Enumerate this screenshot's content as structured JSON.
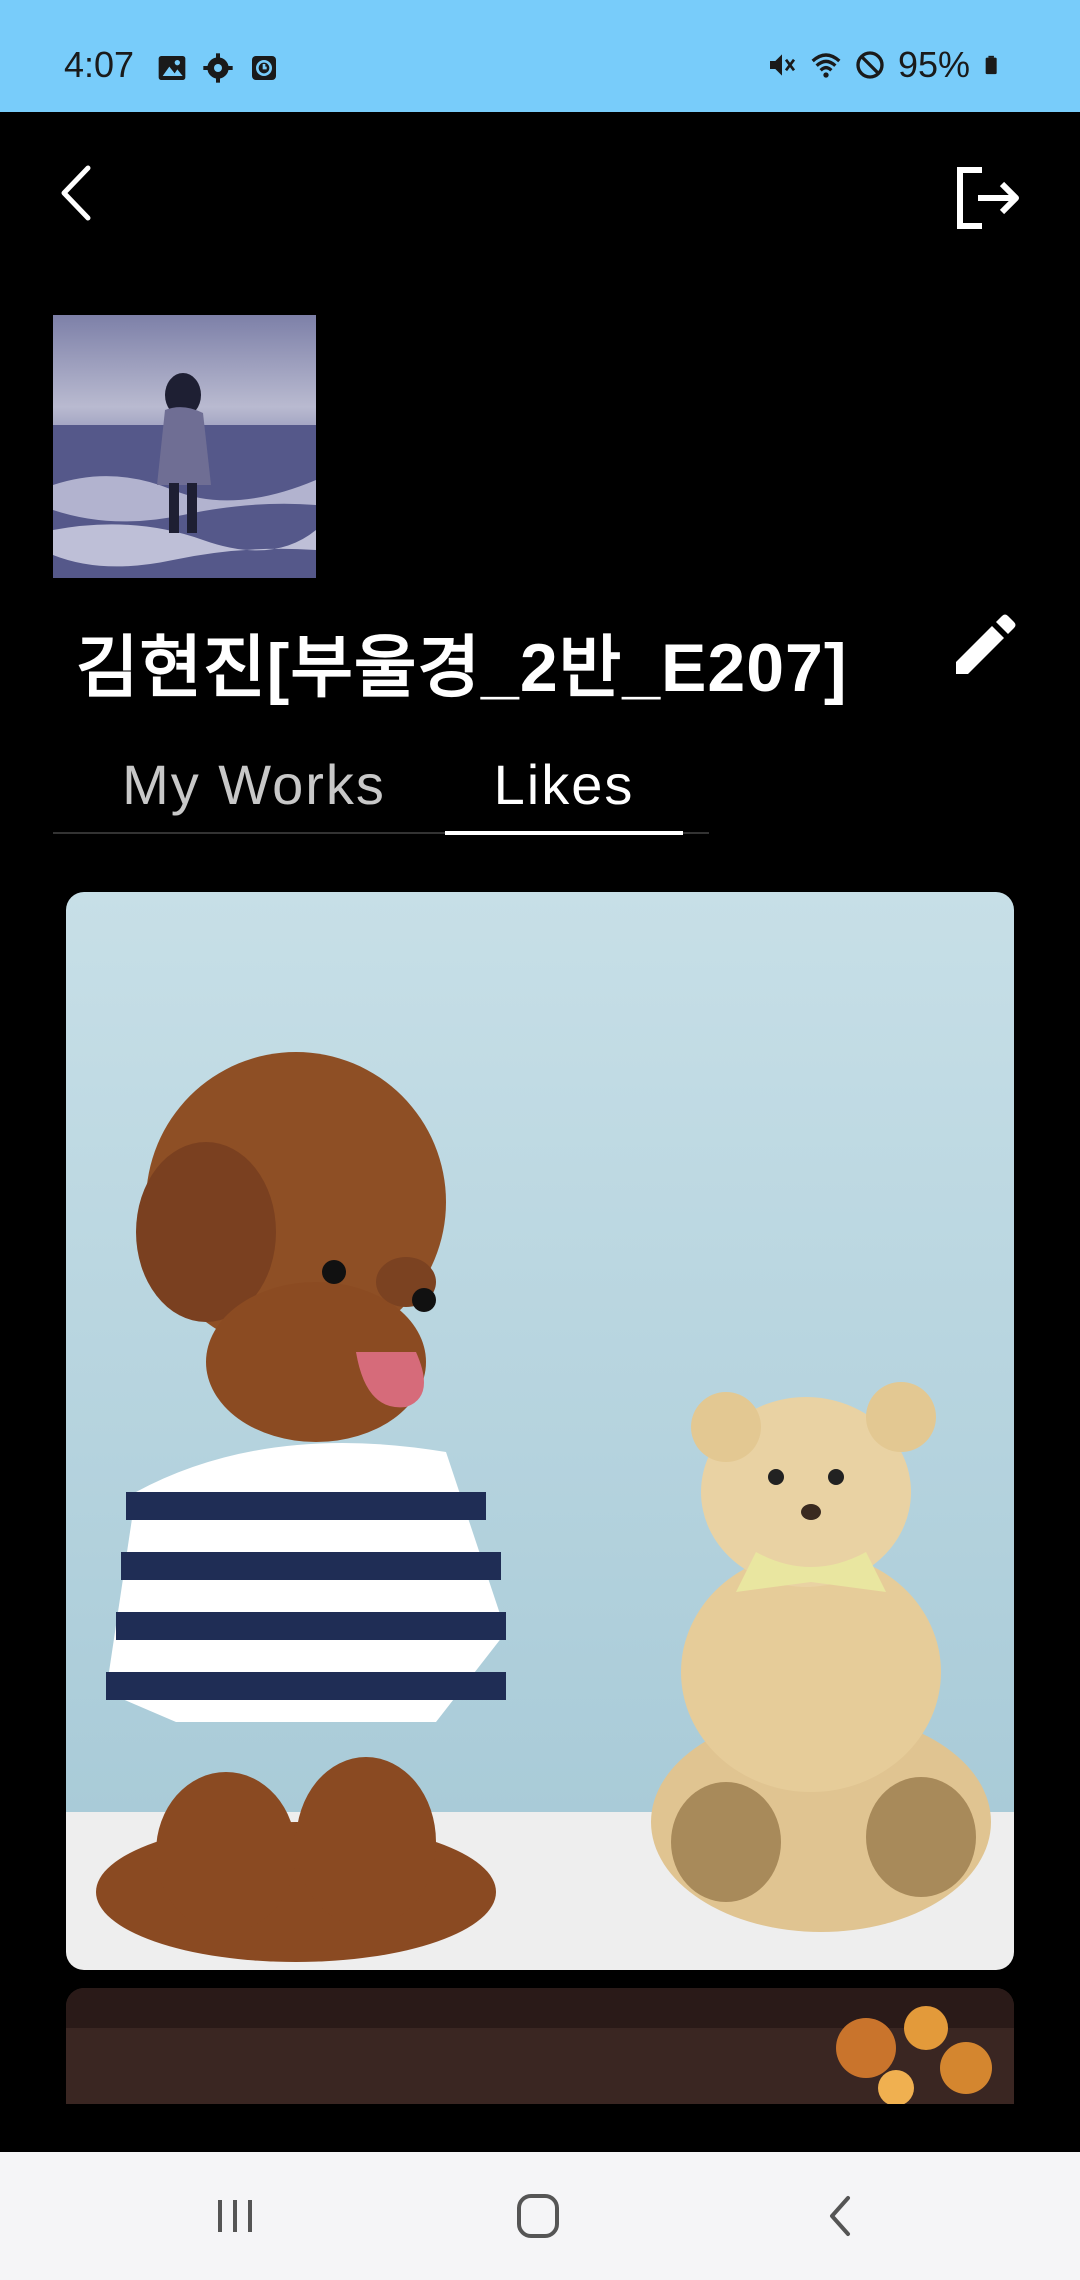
{
  "status": {
    "time": "4:07",
    "battery": "95%",
    "left_icons": [
      "gallery-icon",
      "settings-icon",
      "clock-icon"
    ],
    "right_icons": [
      "mute-icon",
      "wifi-icon",
      "do-not-disturb-icon",
      "battery-icon"
    ]
  },
  "header": {
    "back_icon": "chevron-left-icon",
    "logout_icon": "logout-icon"
  },
  "profile": {
    "username": "김현진[부울경_2반_E207]",
    "edit_icon": "pencil-icon"
  },
  "tabs": [
    {
      "label": "My Works",
      "active": false
    },
    {
      "label": "Likes",
      "active": true
    }
  ],
  "feed": {
    "items": [
      "liked-image",
      "liked-image-partial"
    ]
  },
  "nav": {
    "items": [
      "recent-apps",
      "home",
      "back"
    ]
  },
  "colors": {
    "status_bar": "#78ccfa",
    "background": "#000000",
    "tab_inactive": "#c8c8c8",
    "tab_active": "#ffffff",
    "nav_bar": "#f5f5f7"
  }
}
